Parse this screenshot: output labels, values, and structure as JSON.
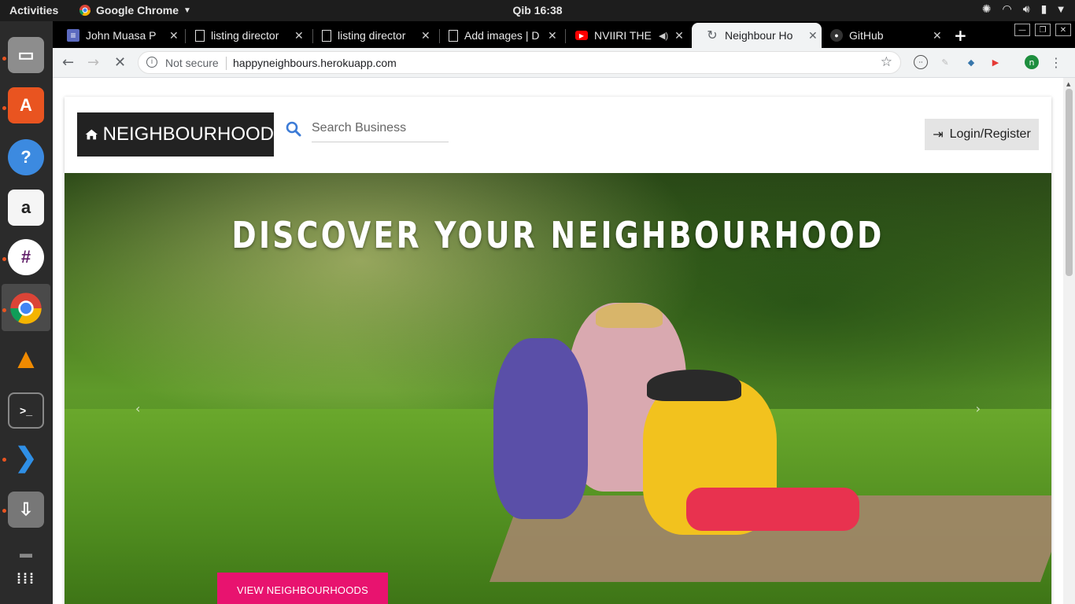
{
  "system": {
    "activities": "Activities",
    "app_menu": "Google Chrome",
    "clock": "Qib 16:38"
  },
  "tabs": [
    {
      "title": "John Muasa P",
      "icon": "docs-icon"
    },
    {
      "title": "listing director",
      "icon": "page-icon"
    },
    {
      "title": "listing director",
      "icon": "page-icon"
    },
    {
      "title": "Add images | D",
      "icon": "page-icon"
    },
    {
      "title": "NVIIRI THE",
      "icon": "youtube-icon"
    },
    {
      "title": "Neighbour Ho",
      "icon": "loading-icon",
      "active": true
    },
    {
      "title": "GitHub",
      "icon": "github-icon"
    }
  ],
  "omnibox": {
    "security": "Not secure",
    "url": "happyneighbours.herokuapp.com"
  },
  "page": {
    "brand": "NEIGHBOURHOOD",
    "search_placeholder": "Search Business",
    "login_label": "Login/Register",
    "hero_title": "DISCOVER YOUR NEIGHBOURHOOD",
    "cta_label": "VIEW NEIGHBOURHOODS"
  },
  "colors": {
    "cta": "#e8136f",
    "brand_bg": "#222222",
    "search_icon": "#3c7bd6"
  }
}
